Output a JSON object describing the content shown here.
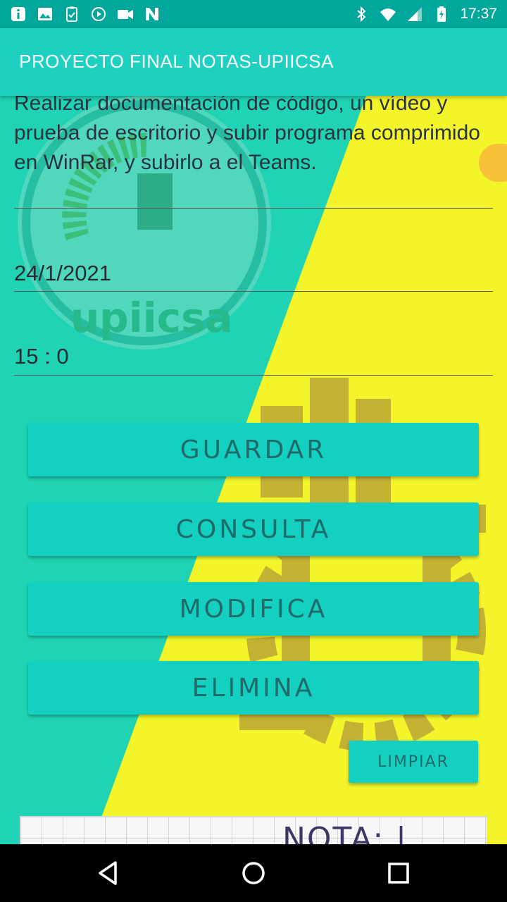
{
  "status_bar": {
    "time": "17:37",
    "left_icons": [
      "info-icon",
      "image-icon",
      "clipboard-icon",
      "play-icon",
      "video-icon",
      "n-app-icon"
    ],
    "right_icons": [
      "bluetooth-icon",
      "wifi-icon",
      "signal-icon",
      "battery-icon"
    ]
  },
  "app_bar": {
    "title": "PROYECTO FINAL NOTAS-UPIICSA"
  },
  "form": {
    "description": "Realizar documentación de código, un vídeo y prueba de escritorio y subir programa comprimido en WinRar, y subirlo a el Teams.",
    "date": "24/1/2021",
    "time": "15 : 0"
  },
  "buttons": {
    "save": "GUARDAR",
    "query": "CONSULTA",
    "modify": "MODIFICA",
    "delete": "ELIMINA",
    "clear": "LIMPIAR"
  },
  "note_card": {
    "title": "NOTA: |"
  },
  "nav_bar": {
    "icons": [
      "back-icon",
      "home-icon",
      "recents-icon"
    ]
  },
  "colors": {
    "status_bar": "#00a79a",
    "app_bar": "#1dd0c0",
    "button": "#14d0c0",
    "button_text": "#1f6a6a",
    "background_teal": "#1fd3b4",
    "background_yellow": "#f3f52a"
  }
}
